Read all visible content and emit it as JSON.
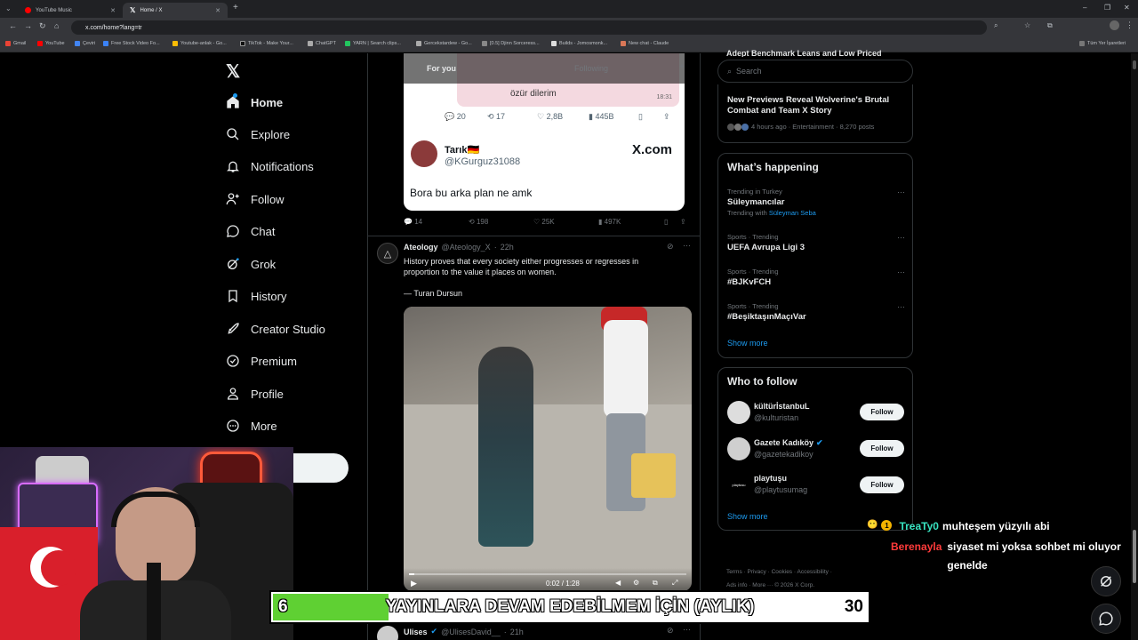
{
  "browser": {
    "tabs": [
      {
        "title": "YouTube Music"
      },
      {
        "title": "Home / X"
      }
    ],
    "url": "x.com/home?lang=tr",
    "bookmarks": [
      "Gmail",
      "YouTube",
      "Çeviri",
      "Free Stock Video Fo...",
      "Youtube-anlak - Go...",
      "TikTok - Make Your...",
      "ChatGPT",
      "YARN | Search clips...",
      "Gercekstardew - Go...",
      "[0.5] Djinn Sorceress...",
      "Builds - Jomosmonk...",
      "New chat - Claude"
    ],
    "all_bookmarks": "Tüm Yer İşaretleri",
    "colors": {
      "tabbar": "#202124",
      "toolbar": "#35363a"
    }
  },
  "sidebar": {
    "logo": "X",
    "items": [
      {
        "label": "Home",
        "icon": "home-icon"
      },
      {
        "label": "Explore",
        "icon": "search-icon"
      },
      {
        "label": "Notifications",
        "icon": "bell-icon"
      },
      {
        "label": "Follow",
        "icon": "person-plus-icon"
      },
      {
        "label": "Chat",
        "icon": "chat-icon"
      },
      {
        "label": "Grok",
        "icon": "grok-icon"
      },
      {
        "label": "History",
        "icon": "bookmark-icon"
      },
      {
        "label": "Creator Studio",
        "icon": "rocket-icon"
      },
      {
        "label": "Premium",
        "icon": "premium-icon"
      },
      {
        "label": "Profile",
        "icon": "person-icon"
      },
      {
        "label": "More",
        "icon": "more-circle-icon"
      }
    ]
  },
  "feed": {
    "tabs": {
      "for_you": "For you",
      "following": "Following"
    },
    "embedded": {
      "bubble_text": "özür dilerim",
      "bubble_time": "18:31",
      "replies": "20",
      "reposts": "17",
      "likes": "2,8B",
      "views": "445B",
      "author": "Tarık🇩🇪",
      "handle": "@KGurguz31088",
      "brand": "X.com",
      "text": "Bora bu arka plan ne amk"
    },
    "tweet1_actions": {
      "replies": "14",
      "reposts": "198",
      "likes": "25K",
      "views": "497K"
    },
    "tweet2": {
      "name": "Ateology",
      "handle": "@Ateology_X",
      "time": "22h",
      "text": "History proves that every society either progresses or regresses in proportion to the value it places on women.",
      "quote": "— Turan Dursun",
      "video_time": "0:02 / 1:28"
    },
    "tweet3": {
      "name": "Ulises",
      "handle": "@UlisesDavid__",
      "time": "21h"
    }
  },
  "right": {
    "search_placeholder": "Search",
    "top_cut": "Adept Benchmark Leans and Low Priced",
    "news": {
      "title": "New Previews Reveal Wolverine's Brutal Combat and Team X Story",
      "meta": "4 hours ago · Entertainment · 8,270 posts"
    },
    "whats_happening": "What’s happening",
    "trends": [
      {
        "context": "Trending in Turkey",
        "name": "Süleymancılar",
        "with_label": "Trending with",
        "with_link": "Süleyman Seba"
      },
      {
        "context": "Sports · Trending",
        "name": "UEFA Avrupa Ligi 3"
      },
      {
        "context": "Sports · Trending",
        "name": "#BJKvFCH"
      },
      {
        "context": "Sports · Trending",
        "name": "#BeşiktaşınMaçıVar"
      }
    ],
    "show_more": "Show more",
    "who_to_follow": "Who to follow",
    "follow_suggestions": [
      {
        "name": "kültürİstanbuL",
        "handle": "@kulturistan",
        "button": "Follow"
      },
      {
        "name": "Gazete Kadıköy",
        "handle": "@gazetekadikoy",
        "button": "Follow"
      },
      {
        "name": "playtuşu",
        "handle": "@playtusumag",
        "button": "Follow"
      }
    ],
    "show_more_2": "Show more",
    "footer": [
      "Terms",
      "Privacy",
      "Cookies",
      "Accessibility",
      "Ads info",
      "More ···",
      "© 2026 X Corp."
    ],
    "accent": "#1d9bf0"
  },
  "stream": {
    "chat": [
      {
        "user": "TreaTy0",
        "badge": "1",
        "message": "muhteşem yüzyılı abi",
        "color": "#38e3c1"
      },
      {
        "user": "Berenayla",
        "message": "siyaset mi yoksa sohbet mi oluyor genelde",
        "color": "#ff3b3b"
      }
    ],
    "goal": {
      "current": "6",
      "text": "YAYINLARA DEVAM EDEBİLMEM İÇİN (AYLIK)",
      "target": "30",
      "fill_fraction": 0.2
    }
  }
}
